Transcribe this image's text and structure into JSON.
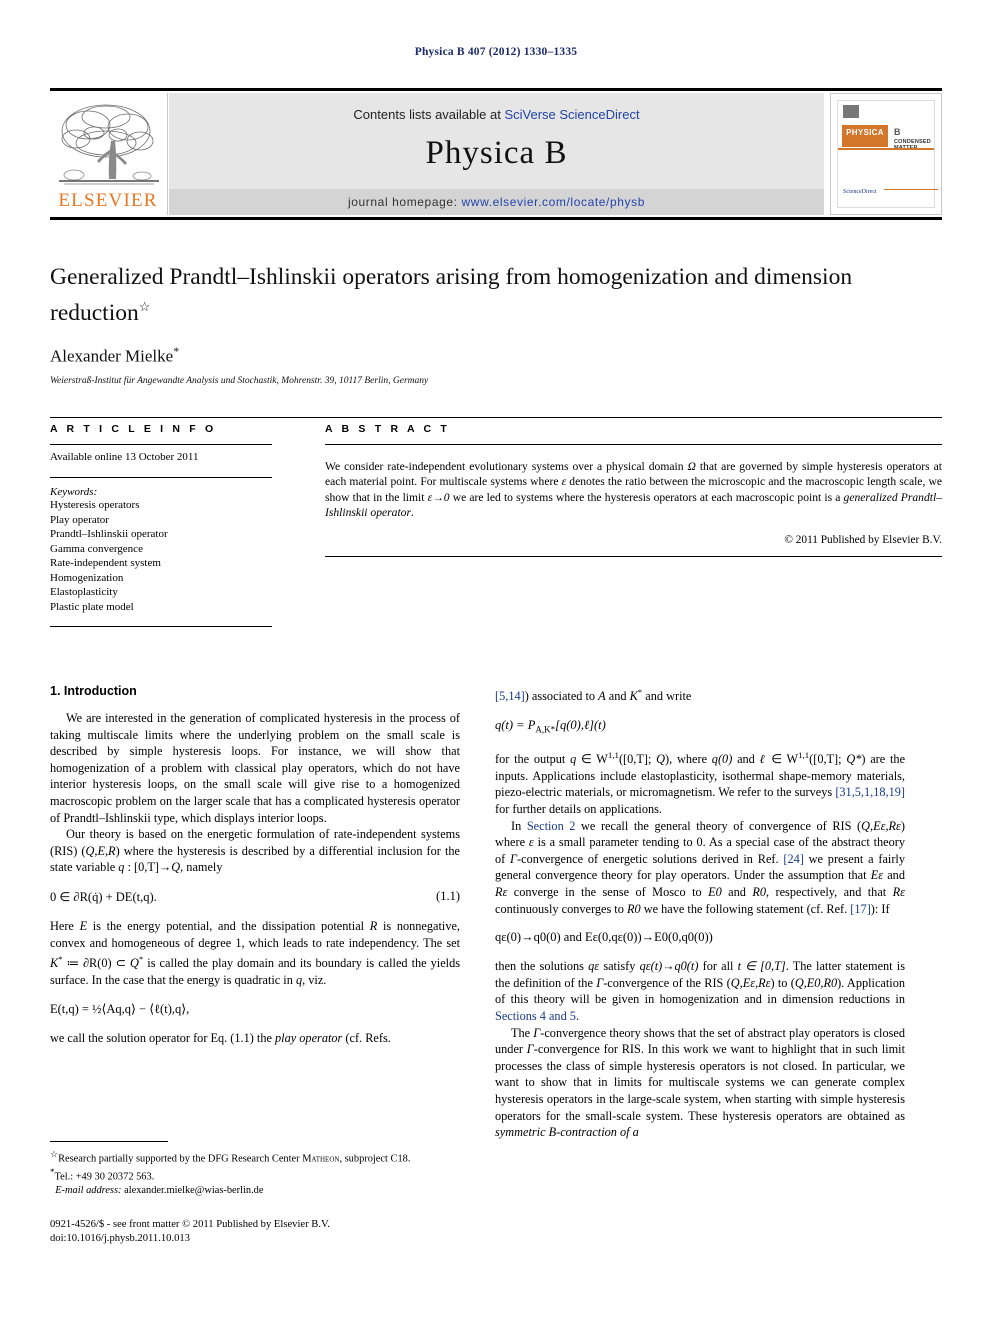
{
  "running_head": "Physica B 407 (2012) 1330–1335",
  "masthead": {
    "contents_prefix": "Contents lists available at ",
    "contents_link": "SciVerse ScienceDirect",
    "journal_title": "Physica B",
    "homepage_prefix": "journal homepage: ",
    "homepage_url": "www.elsevier.com/locate/physb",
    "publisher_logo_text": "ELSEVIER",
    "cover": {
      "brand": "PHYSICA",
      "letter": "B",
      "subtitle": "CONDENSED MATTER",
      "footer": "ScienceDirect"
    }
  },
  "title": {
    "main": "Generalized Prandtl–Ishlinskii operators arising from homogenization and dimension reduction",
    "star": "☆",
    "author": "Alexander Mielke",
    "author_mark": "*",
    "affiliation": "Weierstraß-Institut für Angewandte Analysis und Stochastik, Mohrenstr. 39, 10117 Berlin, Germany"
  },
  "article_info": {
    "heading": "A R T I C L E  I N F O",
    "history": "Available online 13 October 2011",
    "keywords_label": "Keywords:",
    "keywords": [
      "Hysteresis operators",
      "Play operator",
      "Prandtl–Ishlinskii operator",
      "Gamma convergence",
      "Rate-independent system",
      "Homogenization",
      "Elastoplasticity",
      "Plastic plate model"
    ]
  },
  "abstract": {
    "heading": "A B S T R A C T",
    "text_1": "We consider rate-independent evolutionary systems over a physical domain ",
    "omega": "Ω",
    "text_2": " that are governed by simple hysteresis operators at each material point. For multiscale systems where ",
    "eps1": "ε",
    "text_3": " denotes the ratio between the microscopic and the macroscopic length scale, we show that in the limit ",
    "eps2": "ε→0",
    "text_4": " we are led to systems where the hysteresis operators at each macroscopic point is a ",
    "emph": "generalized Prandtl–Ishlinskii operator",
    "text_5": ".",
    "copyright": "© 2011 Published by Elsevier B.V."
  },
  "body": {
    "section_1_title": "1. Introduction",
    "left": {
      "p1": "We are interested in the generation of complicated hysteresis in the process of taking multiscale limits where the underlying problem on the small scale is described by simple hysteresis loops. For instance, we will show that homogenization of a problem with classical play operators, which do not have interior hysteresis loops, on the small scale will give rise to a homogenized macroscopic problem on the larger scale that has a complicated hysteresis operator of Prandtl–Ishlinskii type, which displays interior loops.",
      "p2_a": "Our theory is based on the energetic formulation of rate-independent systems (RIS) (",
      "p2_qer": "Q,E,R",
      "p2_b": ") where the hysteresis is described by a differential inclusion for the state variable ",
      "p2_q": "q",
      "p2_c": " : [0,T]→",
      "p2_Q": "Q",
      "p2_d": ", namely",
      "eq11_body": "0 ∈ ∂R(q̇) + DE(t,q).",
      "eq11_num": "(1.1)",
      "p3_a": "Here ",
      "p3_E": "E",
      "p3_b": " is the energy potential, and the dissipation potential ",
      "p3_R": "R",
      "p3_c": " is nonnegative, convex and homogeneous of degree 1, which leads to rate independency. The set ",
      "p3_K": "K",
      "p3_d": " ≔ ∂R(0) ⊂ ",
      "p3_Qs": "Q",
      "p3_e": " is called the play domain and its boundary is called the yields surface. In the case that the energy is quadratic in ",
      "p3_q": "q",
      "p3_f": ", viz.",
      "eq_energy": "E(t,q) = ½⟨Aq,q⟩ − ⟨ℓ(t),q⟩,",
      "p4_a": "we call the solution operator for Eq. (1.1) the ",
      "p4_emph": "play operator",
      "p4_b": " (cf. Refs."
    },
    "right": {
      "p1_a": "",
      "ref514": "[5,14]",
      "p1_b": ") associated to ",
      "p1_A": "A",
      "p1_c": " and ",
      "p1_K": "K",
      "p1_d": " and write",
      "eq_play": "q(t) = P",
      "eq_play_sub": "A,K*",
      "eq_play_rest": "[q(0),ℓ](t)",
      "p2_a": "for the output ",
      "p2_q": "q",
      "p2_b": " ∈ W",
      "p2_exp1": "1,1",
      "p2_c": "([0,T]; ",
      "p2_Q": "Q",
      "p2_d": "), where ",
      "p2_q0": "q(0)",
      "p2_e": " and ",
      "p2_ell": "ℓ",
      "p2_f": " ∈ W",
      "p2_exp2": "1,1",
      "p2_g": "([0,T]; ",
      "p2_Qs": "Q*",
      "p2_h": ") are the inputs. Applications include elastoplasticity, isothermal shape-memory materials, piezo-electric materials, or micromagnetism. We refer to the surveys ",
      "refs_surveys": "[31,5,1,18,19]",
      "p2_i": " for further details on applications.",
      "p3_a": "In ",
      "p3_section2": "Section 2",
      "p3_b": " we recall the general theory of convergence of RIS (",
      "p3_qer": "Q,Eε,Rε",
      "p3_c": ") where ",
      "p3_eps": "ε",
      "p3_d": " is a small parameter tending to 0. As a special case of the abstract theory of ",
      "p3_gamma": "Γ",
      "p3_e": "-convergence of energetic solutions derived in Ref. ",
      "ref24": "[24]",
      "p3_f": " we present a fairly general convergence theory for play operators. Under the assumption that ",
      "p3_Eeps": "Eε",
      "p3_g": " and ",
      "p3_Reps": "Rε",
      "p3_h": " converge in the sense of Mosco to ",
      "p3_E0": "E0",
      "p3_i": " and ",
      "p3_R0": "R0",
      "p3_j": ", respectively, and that ",
      "p3_Reps2": "Rε",
      "p3_k": " continuously converges to ",
      "p3_R02": "R0",
      "p3_l": " we have the following statement (cf. Ref. ",
      "ref17": "[17]",
      "p3_m": "): If",
      "eq_conv": "qε(0)→q0(0)   and   Eε(0,qε(0))→E0(0,q0(0))",
      "p4_a": "then the solutions ",
      "p4_qeps": "qε",
      "p4_b": " satisfy ",
      "p4_conv": "qε(t)→q0(t)",
      "p4_c": " for all ",
      "p4_t": "t ∈ [0,T]",
      "p4_d": ". The latter statement is the definition of the ",
      "p4_gamma": "Γ",
      "p4_e": "-convergence of the RIS (",
      "p4_ris1": "Q,Eε,Rε",
      "p4_f": ") to (",
      "p4_ris2": "Q,E0,R0",
      "p4_g": "). Application of this theory will be given in homogenization and in dimension reductions in ",
      "p4_sections": "Sections 4 and 5",
      "p4_h": ".",
      "p5_a": "The ",
      "p5_gamma": "Γ",
      "p5_b": "-convergence theory shows that the set of abstract play operators is closed under ",
      "p5_gamma2": "Γ",
      "p5_c": "-convergence for RIS. In this work we want to highlight that in such limit processes the class of simple hysteresis operators is not closed. In particular, we want to show that in limits for multiscale systems we can generate complex hysteresis operators in the large-scale system, when starting with simple hysteresis operators for the small-scale system. These hysteresis operators are obtained as ",
      "p5_emph": "symmetric B-contraction of a"
    }
  },
  "footnotes": {
    "star_mark": "☆",
    "star_text_a": "Research partially supported by the DFG Research Center ",
    "star_matheon": "Matheon",
    "star_text_b": ", subproject C18.",
    "tel_mark": "*",
    "tel_text": "Tel.: +49 30 20372 563.",
    "email_label": "E-mail address:",
    "email": "alexander.mielke@wias-berlin.de"
  },
  "footer": {
    "issn_line": "0921-4526/$ - see front matter © 2011 Published by Elsevier B.V.",
    "doi_line": "doi:10.1016/j.physb.2011.10.013"
  },
  "colors": {
    "link_blue": "#1a3a8a",
    "elsevier_orange": "#E87722",
    "panel_gray": "#e6e6e6",
    "bar_gray": "#d4d4d4"
  }
}
